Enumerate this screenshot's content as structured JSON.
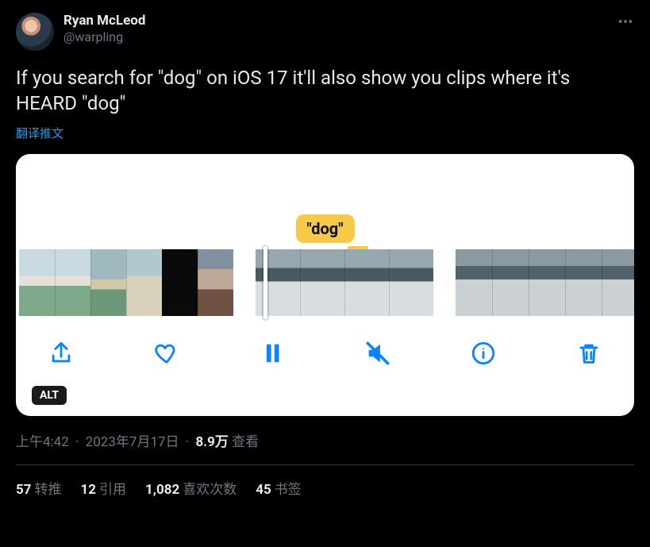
{
  "author": {
    "display_name": "Ryan McLeod",
    "handle": "@warpling"
  },
  "tweet_text": "If you search for \"dog\" on iOS 17 it'll also show you clips where it's HEARD \"dog\"",
  "translate_label": "翻译推文",
  "media": {
    "tag_text": "\"dog\"",
    "alt_badge": "ALT",
    "toolbar": {
      "share": "share",
      "like": "like",
      "pause": "pause",
      "mute": "mute",
      "info": "info",
      "delete": "delete"
    }
  },
  "meta": {
    "time": "上午4:42",
    "date": "2023年7月17日",
    "views_count": "8.9万",
    "views_label": "查看"
  },
  "stats": {
    "retweets": {
      "count": "57",
      "label": "转推"
    },
    "quotes": {
      "count": "12",
      "label": "引用"
    },
    "likes": {
      "count": "1,082",
      "label": "喜欢次数"
    },
    "bookmarks": {
      "count": "45",
      "label": "书签"
    }
  }
}
